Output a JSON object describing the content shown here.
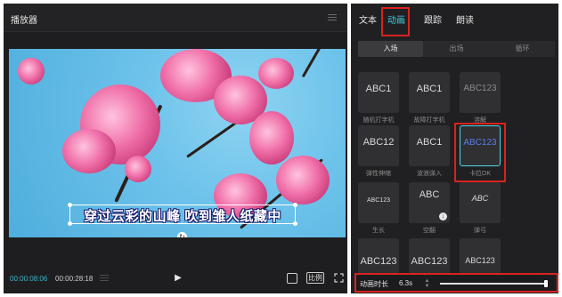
{
  "player": {
    "title": "播放器",
    "subtitle_text": "穿过云彩的山峰 吹到雏人纸藏中",
    "time_current": "00:00:08:06",
    "time_total": "00:00:28:18",
    "ratio_label": "比例"
  },
  "panel": {
    "tabs": [
      {
        "label": "文本",
        "active": false
      },
      {
        "label": "动画",
        "active": true
      },
      {
        "label": "跟踪",
        "active": false
      },
      {
        "label": "朗读",
        "active": false
      }
    ],
    "subtabs": [
      {
        "label": "入场",
        "active": true
      },
      {
        "label": "出场",
        "active": false
      },
      {
        "label": "循环",
        "active": false
      }
    ],
    "animations": [
      {
        "preview": "ABC1",
        "label": "随机打字机"
      },
      {
        "preview": "ABC1",
        "label": "故障打字机"
      },
      {
        "preview": "ABC123",
        "label": "溶解"
      },
      {
        "preview": "ABC12",
        "label": "弹性伸缩"
      },
      {
        "preview": "ABC1",
        "label": "波浪弹入"
      },
      {
        "preview": "ABC123",
        "label": "卡拉OK",
        "selected": true
      },
      {
        "preview": "ABC123",
        "label": "生长"
      },
      {
        "preview": "ABC",
        "label": "空翻",
        "download": true
      },
      {
        "preview": "ABC",
        "label": "弹弓"
      },
      {
        "preview": "ABC123",
        "label": ""
      },
      {
        "preview": "ABC123",
        "label": ""
      },
      {
        "preview": "ABC123",
        "label": ""
      }
    ],
    "duration": {
      "label": "动画时长",
      "value": "6.3s",
      "fraction": 1.0
    }
  },
  "colors": {
    "accent": "#3fd0e0",
    "highlight_red": "#d8221f",
    "panel_bg": "#202022"
  }
}
